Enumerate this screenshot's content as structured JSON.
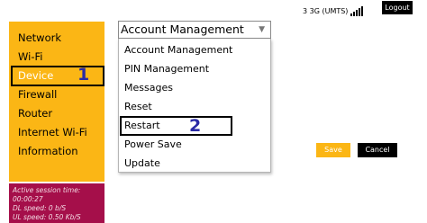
{
  "header": {
    "status_text": "3 3G (UMTS)",
    "signal_icon": "signal-bars-icon",
    "logout_label": "Logout"
  },
  "sidebar": {
    "items": [
      {
        "label": "Network"
      },
      {
        "label": "Wi-Fi"
      },
      {
        "label": "Device"
      },
      {
        "label": "Firewall"
      },
      {
        "label": "Router"
      },
      {
        "label": "Internet Wi-Fi"
      },
      {
        "label": "Information"
      }
    ],
    "active_item": "Device",
    "step_marker": "1"
  },
  "session": {
    "active_time_label": "Active session time:",
    "active_time_value": "00:00:27",
    "dl_speed": "DL speed: 0 b/S",
    "ul_speed": "UL speed: 0.50 Kb/S"
  },
  "management": {
    "selected": "Account Management",
    "options": [
      "Account Management",
      "PIN Management",
      "Messages",
      "Reset",
      "Restart",
      "Power Save",
      "Update"
    ],
    "step_marker": "2"
  },
  "actions": {
    "save_label": "Save",
    "cancel_label": "Cancel"
  },
  "colors": {
    "sidebar_bg": "#fbb615",
    "session_bg": "#a50f4a",
    "annotation_blue": "#2a2aa6"
  }
}
